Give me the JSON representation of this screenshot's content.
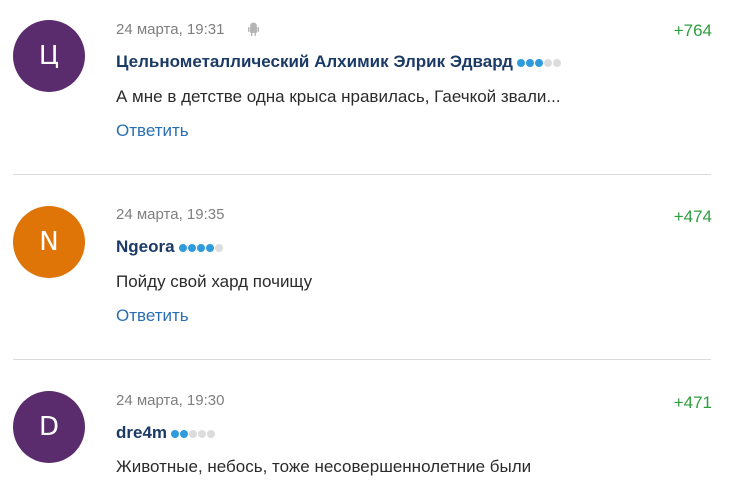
{
  "comments": [
    {
      "avatar_letter": "Ц",
      "avatar_color": "#5a2c6d",
      "date": "24 марта, 19:31",
      "platform_icon": "android-icon",
      "author": "Цельнометаллический Алхимик Элрик Эдвард",
      "rating_dots_filled": 3,
      "rating_dots_total": 5,
      "text": "А мне в детстве одна крыса нравилась, Гаечкой звали...",
      "reply_label": "Ответить",
      "score": "+764"
    },
    {
      "avatar_letter": "N",
      "avatar_color": "#df7407",
      "date": "24 марта, 19:35",
      "author": "Ngeora",
      "rating_dots_filled": 4,
      "rating_dots_total": 5,
      "text": "Пойду свой хард почищу",
      "reply_label": "Ответить",
      "score": "+474"
    },
    {
      "avatar_letter": "D",
      "avatar_color": "#5a2c6d",
      "date": "24 марта, 19:30",
      "author": "dre4m",
      "rating_dots_filled": 2,
      "rating_dots_total": 5,
      "text": "Животные, небось, тоже несовершеннолетние были",
      "score": "+471"
    }
  ]
}
